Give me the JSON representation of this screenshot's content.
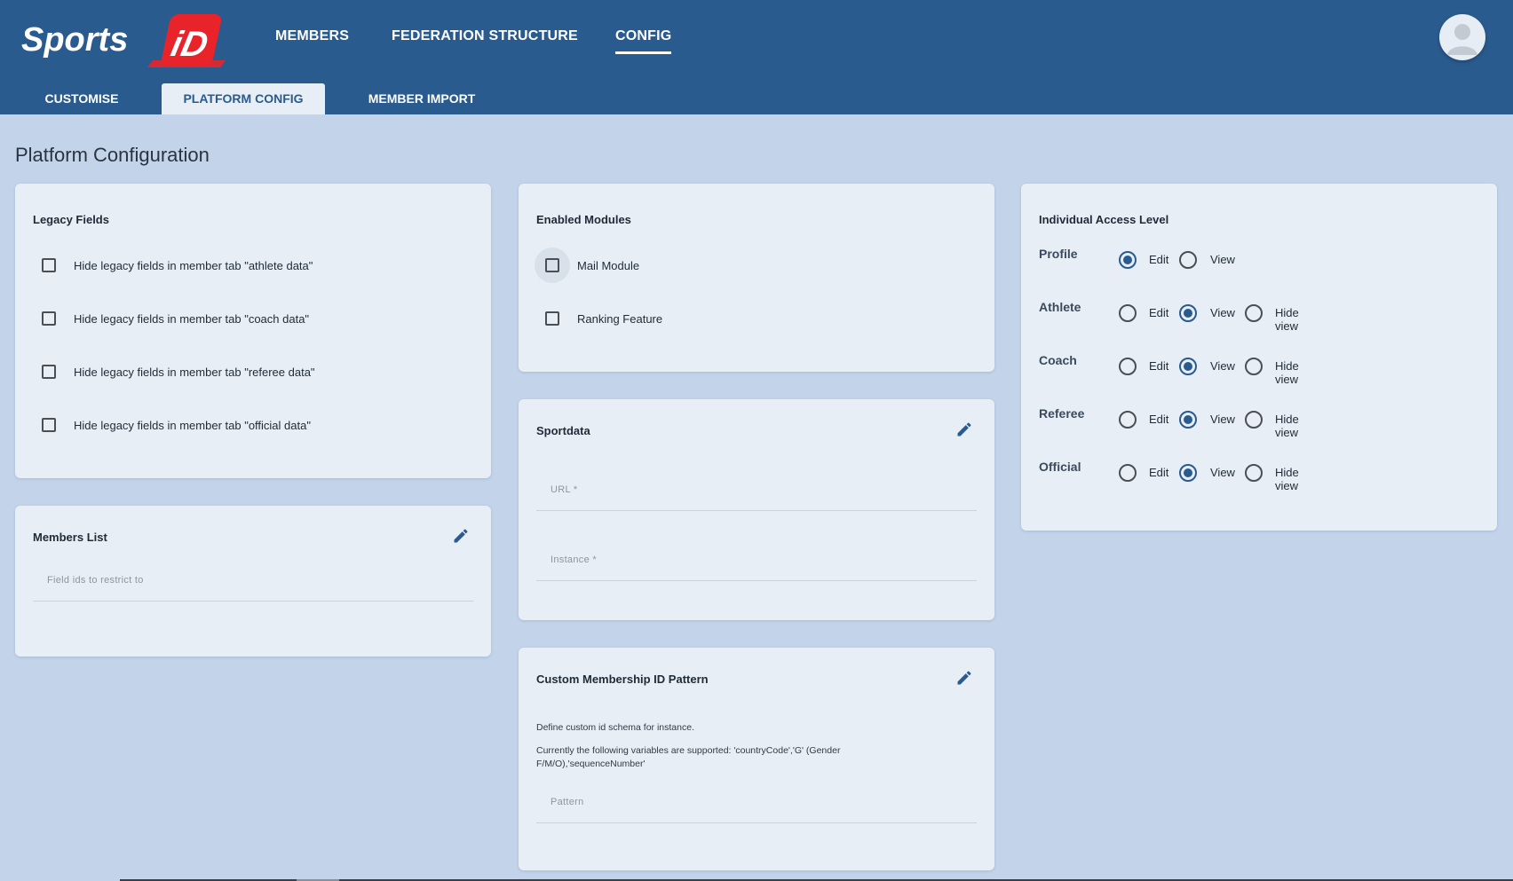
{
  "header": {
    "logo_text": "Sports iD",
    "nav": [
      {
        "label": "MEMBERS"
      },
      {
        "label": "FEDERATION STRUCTURE"
      },
      {
        "label": "CONFIG"
      }
    ]
  },
  "subtabs": [
    {
      "label": "CUSTOMISE"
    },
    {
      "label": "PLATFORM CONFIG"
    },
    {
      "label": "MEMBER IMPORT"
    }
  ],
  "page": {
    "title": "Platform Configuration"
  },
  "legacy_fields": {
    "title": "Legacy Fields",
    "items": [
      {
        "label": "Hide legacy fields in member tab \"athlete data\"",
        "checked": false
      },
      {
        "label": "Hide legacy fields in member tab \"coach data\"",
        "checked": false
      },
      {
        "label": "Hide legacy fields in member tab \"referee data\"",
        "checked": false
      },
      {
        "label": "Hide legacy fields in member tab \"official data\"",
        "checked": false
      }
    ]
  },
  "members_list": {
    "title": "Members List",
    "field_placeholder": "Field ids to restrict to"
  },
  "enabled_modules": {
    "title": "Enabled Modules",
    "items": [
      {
        "label": "Mail Module",
        "checked": false
      },
      {
        "label": "Ranking Feature",
        "checked": false
      }
    ]
  },
  "sportdata": {
    "title": "Sportdata",
    "url_placeholder": "URL *",
    "instance_placeholder": "Instance *"
  },
  "custom_id": {
    "title": "Custom Membership ID Pattern",
    "desc1": "Define custom id schema for instance.",
    "desc2a": "Currently the following variables are supported: 'countryCode','G' (Gender",
    "desc2b": "F/M/O),'sequenceNumber'",
    "pattern_placeholder": "Pattern"
  },
  "access": {
    "title": "Individual Access Level",
    "edit_label": "Edit",
    "view_label": "View",
    "hide_label": "Hide view",
    "rows": [
      {
        "label": "Profile",
        "selected": "Edit"
      },
      {
        "label": "Athlete",
        "selected": "View"
      },
      {
        "label": "Coach",
        "selected": "View"
      },
      {
        "label": "Referee",
        "selected": "View"
      },
      {
        "label": "Official",
        "selected": "View"
      }
    ]
  },
  "colors": {
    "header": "#2a5b8f",
    "background": "#c3d4ea",
    "card": "#e8eef5",
    "logo_red": "#e8232a"
  }
}
